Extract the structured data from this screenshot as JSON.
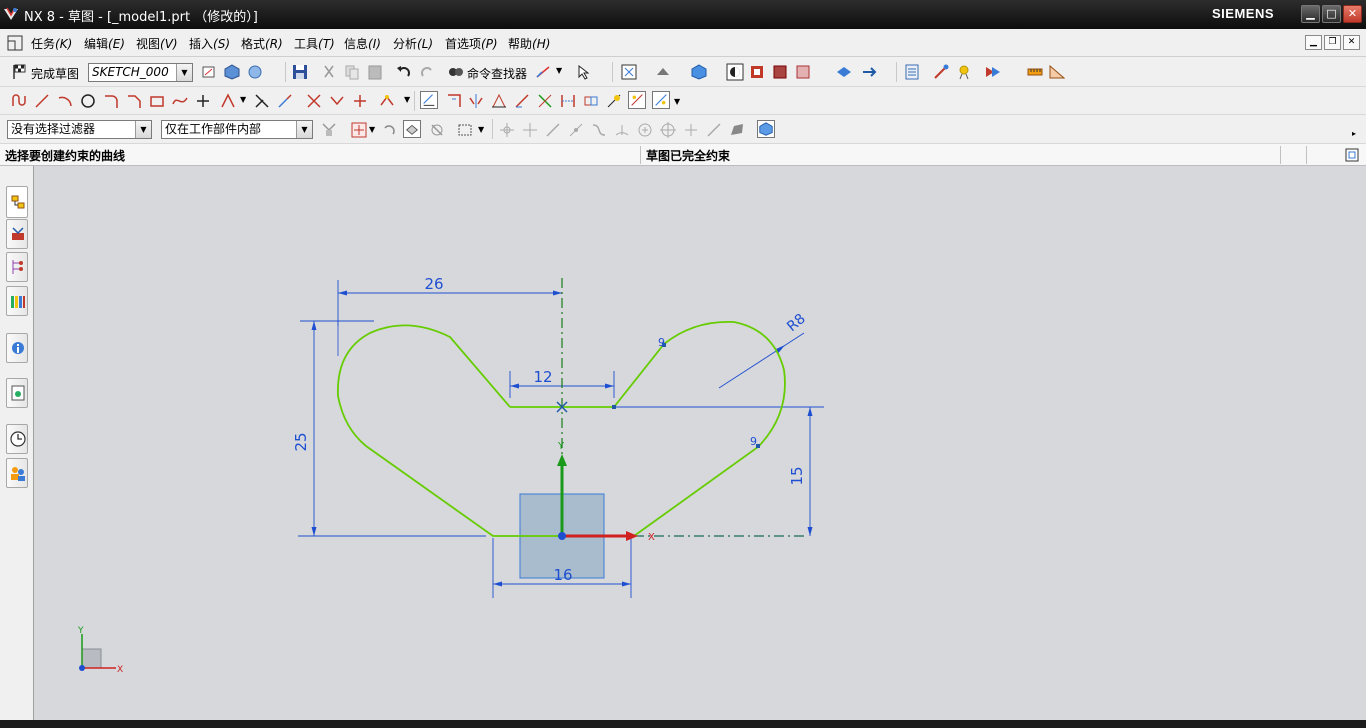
{
  "window": {
    "title": "NX 8 - 草图 - [_model1.prt （修改的）]",
    "brand": "SIEMENS",
    "min_glyph": "▁",
    "max_glyph": "□",
    "close_glyph": "✕"
  },
  "menu": {
    "items": [
      {
        "label": "任务",
        "key": "(K)"
      },
      {
        "label": "编辑",
        "key": "(E)"
      },
      {
        "label": "视图",
        "key": "(V)"
      },
      {
        "label": "插入",
        "key": "(S)"
      },
      {
        "label": "格式",
        "key": "(R)"
      },
      {
        "label": "工具",
        "key": "(T)"
      },
      {
        "label": "信息",
        "key": "(I)"
      },
      {
        "label": "分析",
        "key": "(L)"
      },
      {
        "label": "首选项",
        "key": "(P)"
      },
      {
        "label": "帮助",
        "key": "(H)"
      }
    ]
  },
  "toolbar": {
    "finish_sketch_label": "完成草图",
    "sketch_name_value": "SKETCH_000",
    "command_finder_label": "命令查找器"
  },
  "selection": {
    "filter_value": "没有选择过滤器",
    "scope_value": "仅在工作部件内部"
  },
  "cue": {
    "prompt": "选择要创建约束的曲线",
    "status": "草图已完全约束"
  },
  "sketch": {
    "dimensions": {
      "d26": "26",
      "d12": "12",
      "d25": "25",
      "d15": "15",
      "d16": "16",
      "r8": "R8"
    },
    "tangent_marks": [
      "9",
      "9"
    ],
    "axis_x": "X",
    "axis_y": "Y",
    "triad_x": "X",
    "triad_y": "Y",
    "colors": {
      "curve": "#66cc00",
      "dimension": "#1f4fd1",
      "axis_x": "#d02020",
      "axis_y": "#1a9a1a",
      "plane": "#a9bccd"
    }
  }
}
